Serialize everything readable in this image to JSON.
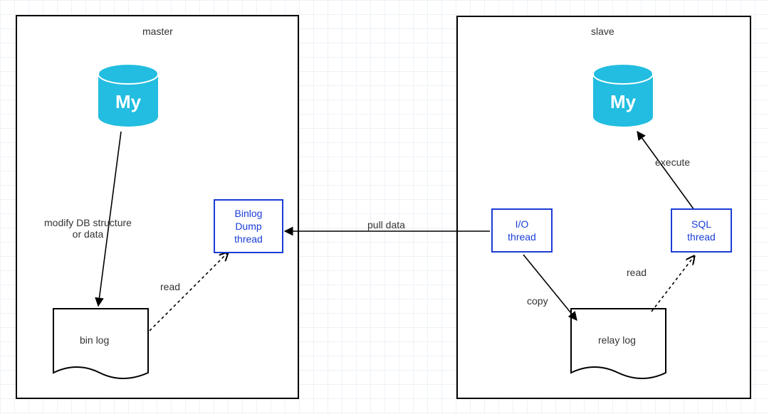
{
  "master": {
    "title": "master",
    "db_icon_text": "My",
    "arrow_modify_label": "modify DB structure\nor data",
    "binlog_file_label": "bin log",
    "binlog_dump_thread": "Binlog\nDump\nthread",
    "read_label": "read"
  },
  "slave": {
    "title": "slave",
    "db_icon_text": "My",
    "io_thread": "I/O\nthread",
    "sql_thread": "SQL\nthread",
    "relay_log_label": "relay log",
    "copy_label": "copy",
    "read_label": "read",
    "execute_label": "execute"
  },
  "pull_data_label": "pull data",
  "colors": {
    "accent_blue": "#1a3dd6",
    "db_cyan": "#22bde0",
    "border_black": "#000000"
  }
}
